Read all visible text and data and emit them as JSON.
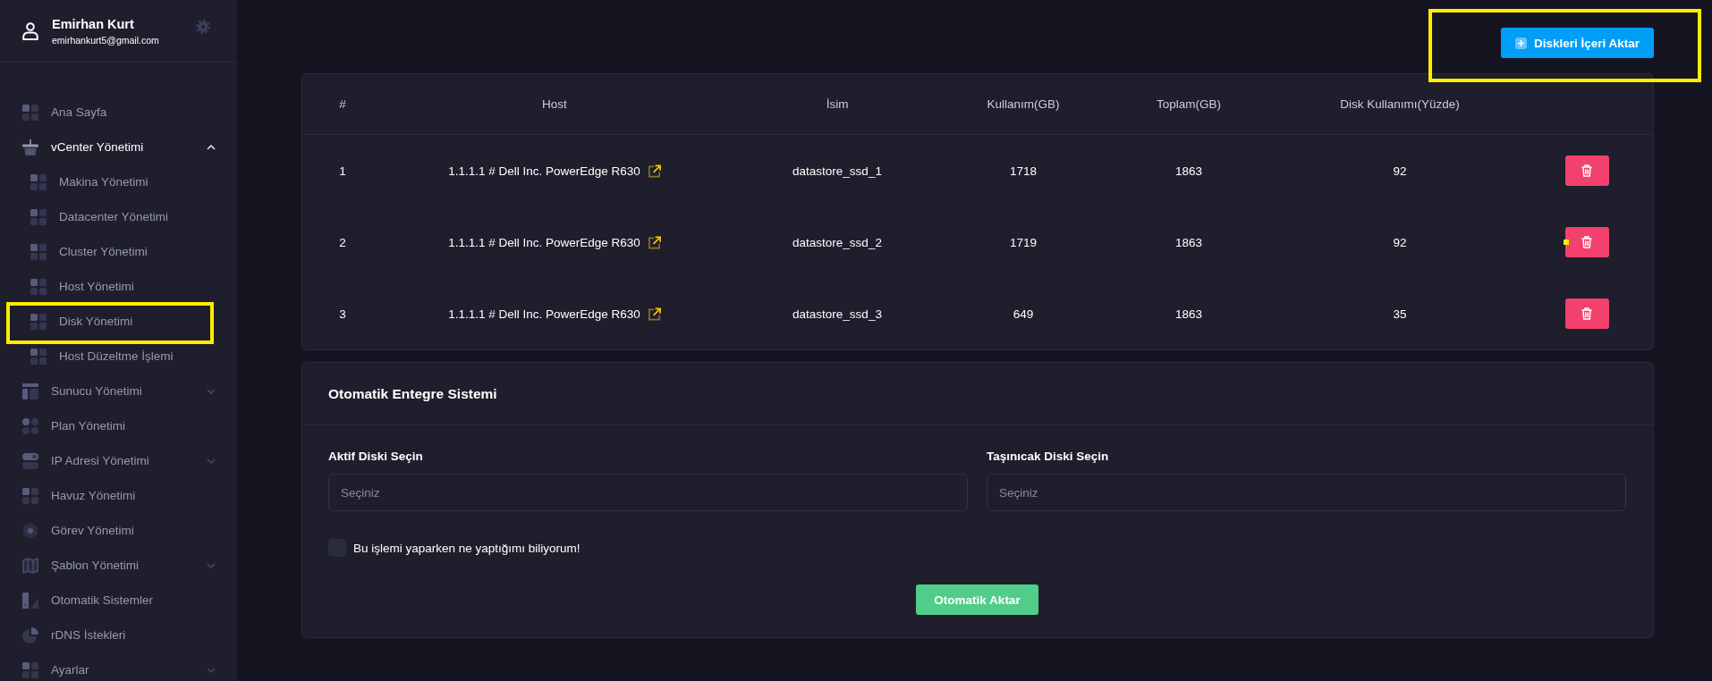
{
  "user": {
    "name": "Emirhan Kurt",
    "email": "emirhankurt5@gmail.com"
  },
  "sidebar": {
    "items": [
      {
        "label": "Ana Sayfa",
        "kind": "link",
        "highlighted": false
      },
      {
        "label": "vCenter Yönetimi",
        "kind": "group",
        "expanded": true,
        "highlighted": false,
        "children": [
          {
            "label": "Makina Yönetimi",
            "highlighted": false
          },
          {
            "label": "Datacenter Yönetimi",
            "highlighted": false
          },
          {
            "label": "Cluster Yönetimi",
            "highlighted": false
          },
          {
            "label": "Host Yönetimi",
            "highlighted": false
          },
          {
            "label": "Disk Yönetimi",
            "highlighted": true
          },
          {
            "label": "Host Düzeltme İşlemi",
            "highlighted": false
          }
        ]
      },
      {
        "label": "Sunucu Yönetimi",
        "kind": "group",
        "expanded": false,
        "highlighted": false
      },
      {
        "label": "Plan Yönetimi",
        "kind": "link",
        "highlighted": false
      },
      {
        "label": "IP Adresi Yönetimi",
        "kind": "group",
        "expanded": false,
        "highlighted": false
      },
      {
        "label": "Havuz Yönetimi",
        "kind": "link",
        "highlighted": false
      },
      {
        "label": "Görev Yönetimi",
        "kind": "link",
        "highlighted": false
      },
      {
        "label": "Şablon Yönetimi",
        "kind": "group",
        "expanded": false,
        "highlighted": false
      },
      {
        "label": "Otomatik Sistemler",
        "kind": "link",
        "highlighted": false
      },
      {
        "label": "rDNS İstekleri",
        "kind": "link",
        "highlighted": false
      },
      {
        "label": "Ayarlar",
        "kind": "group",
        "expanded": false,
        "highlighted": false
      }
    ]
  },
  "import_button": {
    "label": "Diskleri İçeri Aktar",
    "highlighted": true
  },
  "disk_table": {
    "columns": [
      "#",
      "Host",
      "İsim",
      "Kullanım(GB)",
      "Toplam(GB)",
      "Disk Kullanımı(Yüzde)"
    ],
    "rows": [
      {
        "index": "1",
        "host": "1.1.1.1 # Dell Inc. PowerEdge R630",
        "name": "datastore_ssd_1",
        "used": "1718",
        "total": "1863",
        "usage_percent": "92",
        "highlighted": false
      },
      {
        "index": "2",
        "host": "1.1.1.1 # Dell Inc. PowerEdge R630",
        "name": "datastore_ssd_2",
        "used": "1719",
        "total": "1863",
        "usage_percent": "92",
        "highlighted": true
      },
      {
        "index": "3",
        "host": "1.1.1.1 # Dell Inc. PowerEdge R630",
        "name": "datastore_ssd_3",
        "used": "649",
        "total": "1863",
        "usage_percent": "35",
        "highlighted": false
      }
    ]
  },
  "auto_integration": {
    "title": "Otomatik Entegre Sistemi",
    "fields": [
      {
        "label": "Aktif Diski Seçin",
        "placeholder": "Seçiniz"
      },
      {
        "label": "Taşınıcak Diski Seçin",
        "placeholder": "Seçiniz"
      }
    ],
    "confirm": {
      "label": "Bu işlemi yaparken ne yaptığımı biliyorum!",
      "checked": false
    },
    "submit_button": "Otomatik Aktar"
  }
}
